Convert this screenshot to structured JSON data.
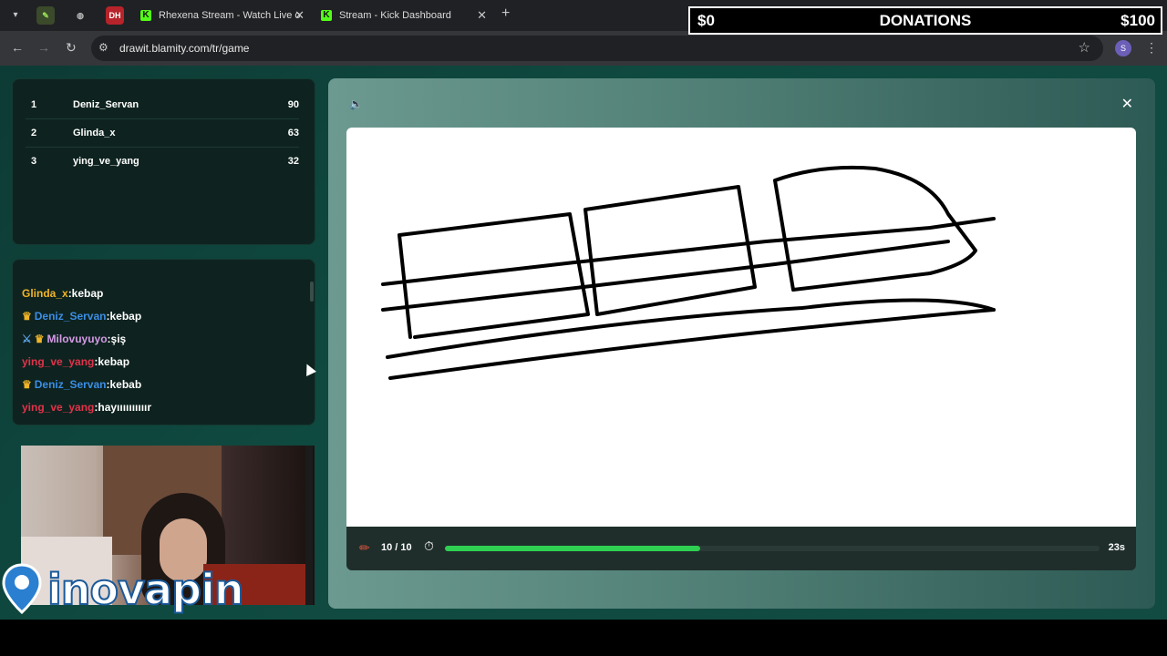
{
  "browser": {
    "pinned": [
      "drawit",
      "web",
      "DH"
    ],
    "tabs": [
      {
        "label": "Rhexena Stream - Watch Live o",
        "close": "✕"
      },
      {
        "label": "Stream - Kick Dashboard",
        "close": "✕"
      }
    ],
    "new_tab": "+",
    "url": "drawit.blamity.com/tr/game",
    "profile_initial": "S"
  },
  "donations": {
    "current": "$0",
    "title": "DONATIONS",
    "goal": "$100"
  },
  "leaderboard": [
    {
      "rank": "1",
      "name": "Deniz_Servan",
      "score": "90"
    },
    {
      "rank": "2",
      "name": "Glinda_x",
      "score": "63"
    },
    {
      "rank": "3",
      "name": "ying_ve_yang",
      "score": "32"
    }
  ],
  "chat": [
    {
      "user": "Glinda_x",
      "msg": ":kebap",
      "color": "#f0b429",
      "crown": false,
      "sword": false
    },
    {
      "user": "Deniz_Servan",
      "msg": ":kebap",
      "color": "#3b8ee6",
      "crown": true,
      "sword": false
    },
    {
      "user": "Milovuyuyo",
      "msg": ":şiş",
      "color": "#d59ae8",
      "crown": true,
      "sword": true
    },
    {
      "user": "ying_ve_yang",
      "msg": ":kebap",
      "color": "#e0334a",
      "crown": false,
      "sword": false
    },
    {
      "user": "Deniz_Servan",
      "msg": ":kebab",
      "color": "#3b8ee6",
      "crown": true,
      "sword": false
    },
    {
      "user": "ying_ve_yang",
      "msg": ":hayıııııııııır",
      "color": "#e0334a",
      "crown": false,
      "sword": false
    }
  ],
  "sponsor": {
    "logo_text": "inovapin"
  },
  "game": {
    "rounds": "10 / 10",
    "timer_progress": 0.39,
    "time_left": "23s"
  }
}
